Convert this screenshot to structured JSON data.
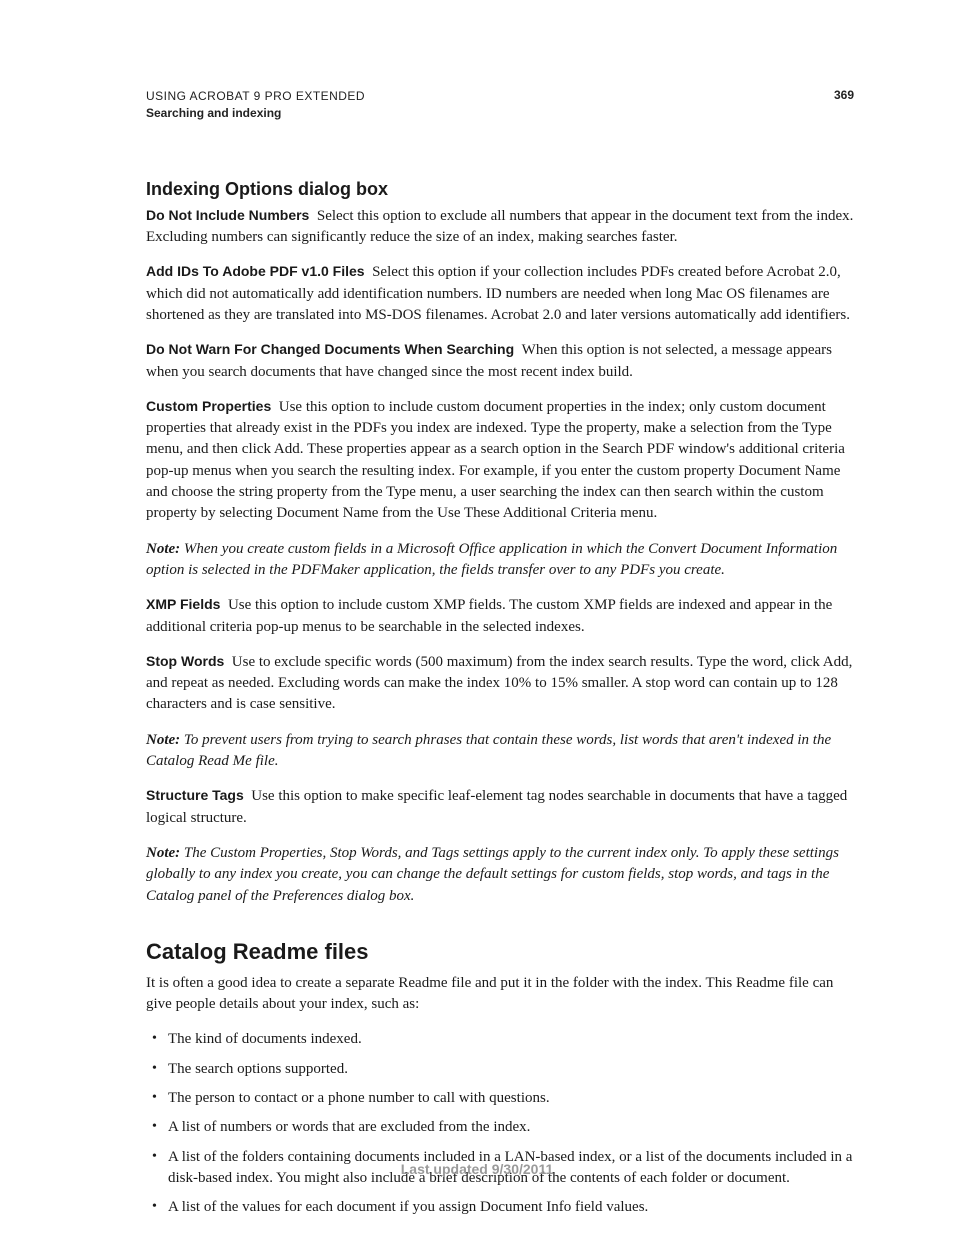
{
  "header": {
    "title": "USING ACROBAT 9 PRO EXTENDED",
    "section": "Searching and indexing",
    "page_number": "369"
  },
  "section1": {
    "heading": "Indexing Options dialog box",
    "items": {
      "do_not_include_numbers": {
        "term": "Do Not Include Numbers",
        "body": "Select this option to exclude all numbers that appear in the document text from the index. Excluding numbers can significantly reduce the size of an index, making searches faster."
      },
      "add_ids": {
        "term": "Add IDs To Adobe PDF v1.0 Files",
        "body": "Select this option if your collection includes PDFs created before Acrobat 2.0, which did not automatically add identification numbers. ID numbers are needed when long Mac OS filenames are shortened as they are translated into MS-DOS filenames. Acrobat 2.0 and later versions automatically add identifiers."
      },
      "do_not_warn": {
        "term": "Do Not Warn For Changed Documents When Searching",
        "body": "When this option is not selected, a message appears when you search documents that have changed since the most recent index build."
      },
      "custom_properties": {
        "term": "Custom Properties",
        "body": "Use this option to include custom document properties in the index; only custom document properties that already exist in the PDFs you index are indexed. Type the property, make a selection from the Type menu, and then click Add. These properties appear as a search option in the Search PDF window's additional criteria pop-up menus when you search the resulting index. For example, if you enter the custom property Document Name and choose the string property from the Type menu, a user searching the index can then search within the custom property by selecting Document Name from the Use These Additional Criteria menu."
      },
      "note1": {
        "label": "Note:",
        "body": "When you create custom fields in a Microsoft Office application in which the Convert Document Information option is selected in the PDFMaker application, the fields transfer over to any PDFs you create."
      },
      "xmp_fields": {
        "term": "XMP Fields",
        "body": "Use this option to include custom XMP fields. The custom XMP fields are indexed and appear in the additional criteria pop-up menus to be searchable in the selected indexes."
      },
      "stop_words": {
        "term": "Stop Words",
        "body": "Use to exclude specific words (500 maximum) from the index search results. Type the word, click Add, and repeat as needed. Excluding words can make the index 10% to 15% smaller. A stop word can contain up to 128 characters and is case sensitive."
      },
      "note2": {
        "label": "Note:",
        "body": "To prevent users from trying to search phrases that contain these words, list words that aren't indexed in the Catalog Read Me file."
      },
      "structure_tags": {
        "term": "Structure Tags",
        "body": "Use this option to make specific leaf-element tag nodes searchable in documents that have a tagged logical structure."
      },
      "note3": {
        "label": "Note:",
        "body": "The Custom Properties, Stop Words, and Tags settings apply to the current index only. To apply these settings globally to any index you create, you can change the default settings for custom fields, stop words, and tags in the Catalog panel of the Preferences dialog box."
      }
    }
  },
  "section2": {
    "heading": "Catalog Readme files",
    "intro": "It is often a good idea to create a separate Readme file and put it in the folder with the index. This Readme file can give people details about your index, such as:",
    "bullets": [
      "The kind of documents indexed.",
      "The search options supported.",
      "The person to contact or a phone number to call with questions.",
      "A list of numbers or words that are excluded from the index.",
      "A list of the folders containing documents included in a LAN-based index, or a list of the documents included in a disk-based index. You might also include a brief description of the contents of each folder or document.",
      "A list of the values for each document if you assign Document Info field values."
    ]
  },
  "footer": {
    "updated": "Last updated 9/30/2011"
  }
}
